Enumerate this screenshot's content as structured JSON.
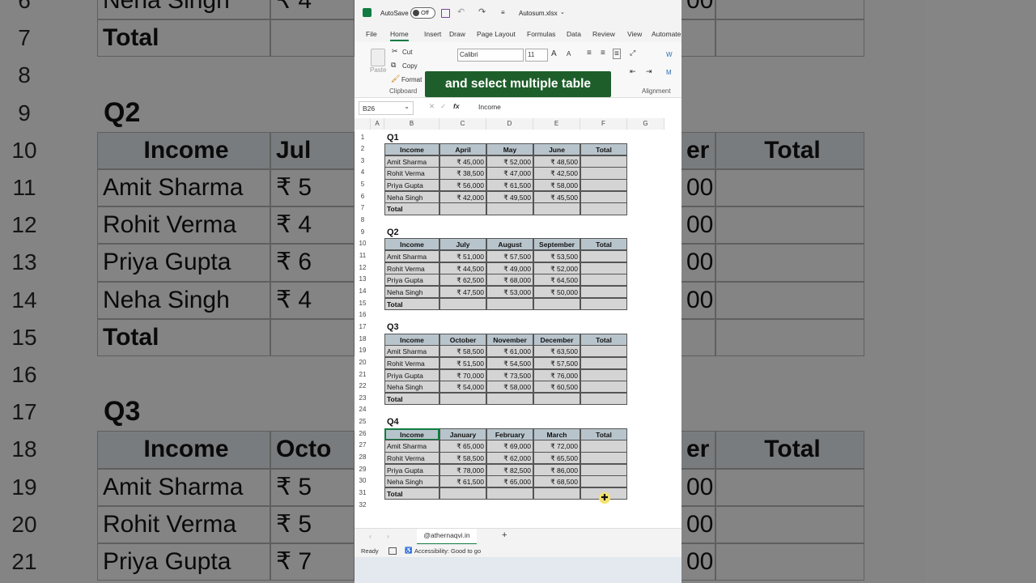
{
  "window": {
    "autosave_label": "AutoSave",
    "autosave_state": "Off",
    "file_name": "Autosum.xlsx"
  },
  "menu": [
    "File",
    "Home",
    "Insert",
    "Draw",
    "Page Layout",
    "Formulas",
    "Data",
    "Review",
    "View",
    "Automate"
  ],
  "ribbon": {
    "paste": "Paste",
    "cut": "Cut",
    "copy": "Copy",
    "format": "Format",
    "clipboard_group": "Clipboard",
    "font_name": "Calibri",
    "font_size": "11",
    "grow_font": "A",
    "shrink_font": "A",
    "alignment_group": "Alignment",
    "wrap": "W",
    "merge": "M"
  },
  "formula_bar": {
    "name_box": "B26",
    "fx": "fx",
    "value": "Income"
  },
  "caption": "and select multiple table",
  "columns": [
    "A",
    "B",
    "C",
    "D",
    "E",
    "F",
    "G"
  ],
  "rows": [
    "1",
    "2",
    "3",
    "4",
    "5",
    "6",
    "7",
    "8",
    "9",
    "10",
    "11",
    "12",
    "13",
    "14",
    "15",
    "16",
    "17",
    "18",
    "19",
    "20",
    "21",
    "22",
    "23",
    "24",
    "25",
    "26",
    "27",
    "28",
    "29",
    "30",
    "31",
    "32"
  ],
  "quarters": [
    {
      "title": "Q1",
      "headers": [
        "Income",
        "April",
        "May",
        "June",
        "Total"
      ],
      "rows": [
        [
          "Amit Sharma",
          "₹ 45,000",
          "₹ 52,000",
          "₹ 48,500",
          ""
        ],
        [
          "Rohit Verma",
          "₹ 38,500",
          "₹ 47,000",
          "₹ 42,500",
          ""
        ],
        [
          "Priya Gupta",
          "₹ 56,000",
          "₹ 61,500",
          "₹ 58,000",
          ""
        ],
        [
          "Neha Singh",
          "₹ 42,000",
          "₹ 49,500",
          "₹ 45,500",
          ""
        ]
      ],
      "total_label": "Total"
    },
    {
      "title": "Q2",
      "headers": [
        "Income",
        "July",
        "August",
        "September",
        "Total"
      ],
      "rows": [
        [
          "Amit Sharma",
          "₹ 51,000",
          "₹ 57,500",
          "₹ 53,500",
          ""
        ],
        [
          "Rohit Verma",
          "₹ 44,500",
          "₹ 49,000",
          "₹ 52,000",
          ""
        ],
        [
          "Priya Gupta",
          "₹ 62,500",
          "₹ 68,000",
          "₹ 64,500",
          ""
        ],
        [
          "Neha Singh",
          "₹ 47,500",
          "₹ 53,000",
          "₹ 50,000",
          ""
        ]
      ],
      "total_label": "Total"
    },
    {
      "title": "Q3",
      "headers": [
        "Income",
        "October",
        "November",
        "December",
        "Total"
      ],
      "rows": [
        [
          "Amit Sharma",
          "₹ 58,500",
          "₹ 61,000",
          "₹ 63,500",
          ""
        ],
        [
          "Rohit Verma",
          "₹ 51,500",
          "₹ 54,500",
          "₹ 57,500",
          ""
        ],
        [
          "Priya Gupta",
          "₹ 70,000",
          "₹ 73,500",
          "₹ 76,000",
          ""
        ],
        [
          "Neha Singh",
          "₹ 54,000",
          "₹ 58,000",
          "₹ 60,500",
          ""
        ]
      ],
      "total_label": "Total"
    },
    {
      "title": "Q4",
      "headers": [
        "Income",
        "January",
        "February",
        "March",
        "Total"
      ],
      "rows": [
        [
          "Amit Sharma",
          "₹ 65,000",
          "₹ 69,000",
          "₹ 72,000",
          ""
        ],
        [
          "Rohit Verma",
          "₹ 58,500",
          "₹ 62,000",
          "₹ 65,500",
          ""
        ],
        [
          "Priya Gupta",
          "₹ 78,000",
          "₹ 82,500",
          "₹ 86,000",
          ""
        ],
        [
          "Neha Singh",
          "₹ 61,500",
          "₹ 65,000",
          "₹ 68,500",
          ""
        ]
      ],
      "total_label": "Total"
    }
  ],
  "sheet_tab": "@athernaqvi.in",
  "add_sheet": "+",
  "status": {
    "ready": "Ready",
    "accessibility": "Accessibility: Good to go"
  },
  "background_zoom": {
    "rows": [
      "6",
      "7",
      "8",
      "9",
      "10",
      "11",
      "12",
      "13",
      "14",
      "15",
      "16",
      "17",
      "18",
      "19",
      "20",
      "21"
    ],
    "left_cells": [
      "Neha Singh",
      "Total",
      "",
      "Q2",
      "Income",
      "Amit Sharma",
      "Rohit Verma",
      "Priya Gupta",
      "Neha Singh",
      "Total",
      "",
      "Q3",
      "Income",
      "Amit Sharma",
      "Rohit Verma",
      "Priya Gupta"
    ],
    "mid_cells": [
      "₹ 4",
      "",
      "",
      "",
      "Jul",
      "₹ 5",
      "₹ 4",
      "₹ 6",
      "₹ 4",
      "",
      "",
      "",
      "Octo",
      "₹ 5",
      "₹ 5",
      "₹ 7"
    ],
    "right_a": [
      "00",
      "",
      "",
      "",
      "er",
      "00",
      "00",
      "00",
      "00",
      "",
      "",
      "",
      "er",
      "00",
      "00",
      "00"
    ],
    "right_b": [
      "",
      "",
      "",
      "",
      "Total",
      "",
      "",
      "",
      "",
      "",
      "",
      "",
      "Total",
      "",
      "",
      ""
    ]
  }
}
